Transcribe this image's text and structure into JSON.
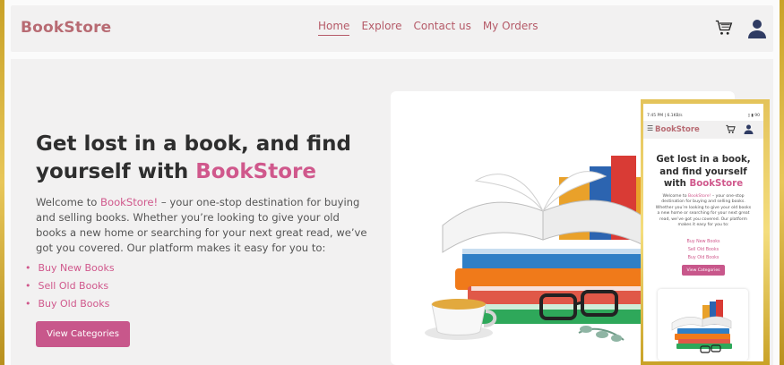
{
  "colors": {
    "brand": "#d0588c",
    "logo": "#b86b73",
    "nav": "#b55a68",
    "gold": "#d9b340"
  },
  "header": {
    "logo": "BookStore",
    "nav": [
      "Home",
      "Explore",
      "Contact us",
      "My Orders"
    ],
    "icons": [
      "cart-icon",
      "user-icon"
    ]
  },
  "hero": {
    "title_part1": "Get lost in a book, and find yourself with ",
    "title_brand": "BookStore",
    "desc_part1": "Welcome to ",
    "desc_brand": "BookStore!",
    "desc_part2": " – your one-stop destination for buying and selling books. Whether you’re looking to give your old books a new home or searching for your next great read, we’ve got you covered. Our platform makes it easy for you to:",
    "features": [
      "Buy New Books",
      "Sell Old Books",
      "Buy Old Books"
    ],
    "cta": "View Categories"
  },
  "phone": {
    "status_time": "7:45 PM | 6.1KB/s",
    "status_right": "▯ ▮ 90",
    "menu_icon": "☰",
    "logo": "BookStore",
    "title_part1": "Get lost in a book, and find yourself with ",
    "title_brand": "BookStore",
    "desc_part1": "Welcome to ",
    "desc_brand": "BookStore!",
    "desc_part2": " – your one-stop destination for buying and selling books. Whether you’re looking to give your old books a new home or searching for your next great read, we’ve got you covered. Our platform makes it easy for you to:",
    "features": [
      "Buy New Books",
      "Sell Old Books",
      "Buy Old Books"
    ],
    "cta": "View Categories"
  }
}
